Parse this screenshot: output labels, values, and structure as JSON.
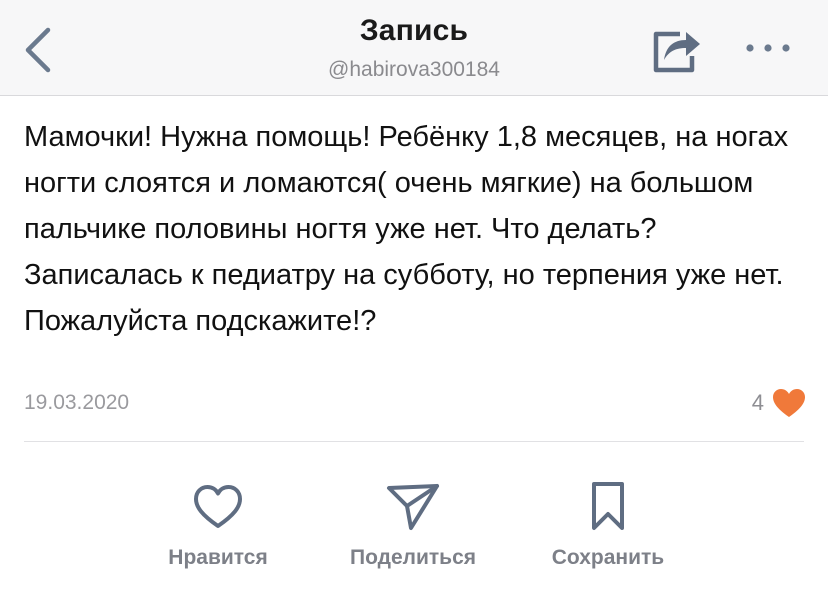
{
  "header": {
    "title": "Запись",
    "handle": "@habirova300184",
    "back_icon": "chevron-left-icon",
    "share_icon": "share-icon",
    "more_icon": "more-icon"
  },
  "post": {
    "text": "Мамочки! Нужна помощь! Ребёнку 1,8 месяцев, на ногах ногти слоятся и ломаются( очень мягкие) на большом пальчике половины ногтя уже нет. Что делать? Записалась к педиатру на субботу, но терпения уже нет. Пожалуйста подскажите!?",
    "date": "19.03.2020",
    "likes_count": "4",
    "like_color": "#f0793a"
  },
  "actions": [
    {
      "label": "Нравится",
      "icon": "heart-icon"
    },
    {
      "label": "Поделиться",
      "icon": "send-icon"
    },
    {
      "label": "Сохранить",
      "icon": "bookmark-icon"
    }
  ],
  "colors": {
    "accent_icon": "#5f6d82",
    "header_bg": "#f7f7f8"
  }
}
